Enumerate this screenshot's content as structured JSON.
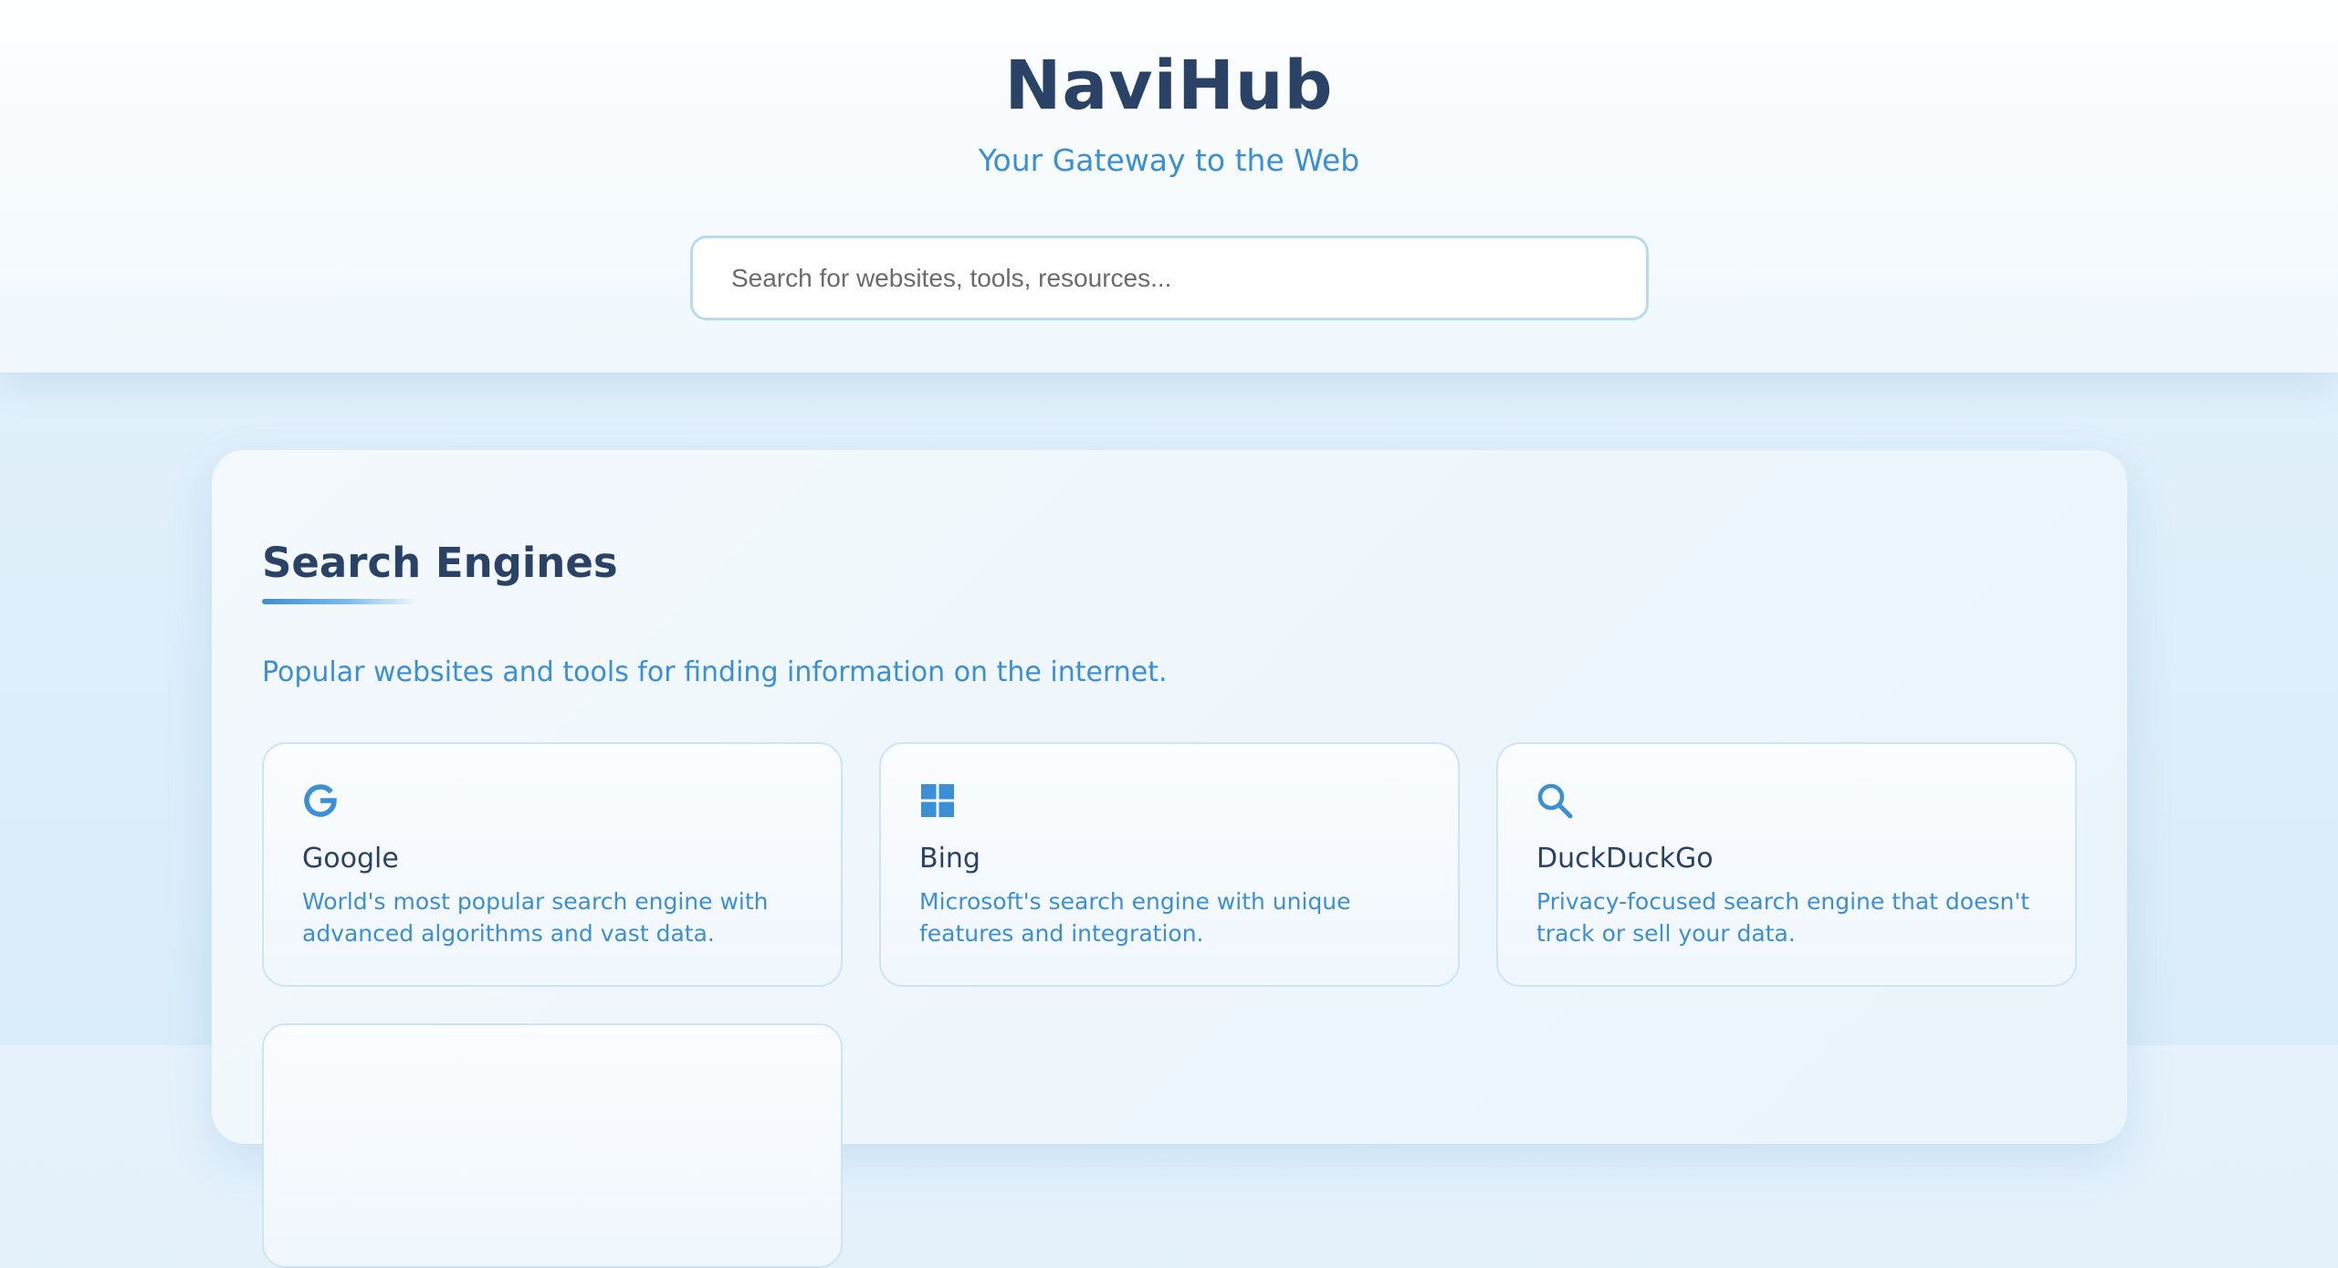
{
  "header": {
    "title": "NaviHub",
    "tagline": "Your Gateway to the Web",
    "search_placeholder": "Search for websites, tools, resources..."
  },
  "section": {
    "title": "Search Engines",
    "description": "Popular websites and tools for finding information on the internet.",
    "cards": [
      {
        "icon": "google-icon",
        "title": "Google",
        "description": "World's most popular search engine with advanced algorithms and vast data."
      },
      {
        "icon": "windows-icon",
        "title": "Bing",
        "description": "Microsoft's search engine with unique features and integration."
      },
      {
        "icon": "search-icon",
        "title": "DuckDuckGo",
        "description": "Privacy-focused search engine that doesn't track or sell your data."
      }
    ]
  },
  "colors": {
    "title": "#2a4266",
    "accent": "#3b8fd4",
    "card_border": "#cde5f3"
  }
}
